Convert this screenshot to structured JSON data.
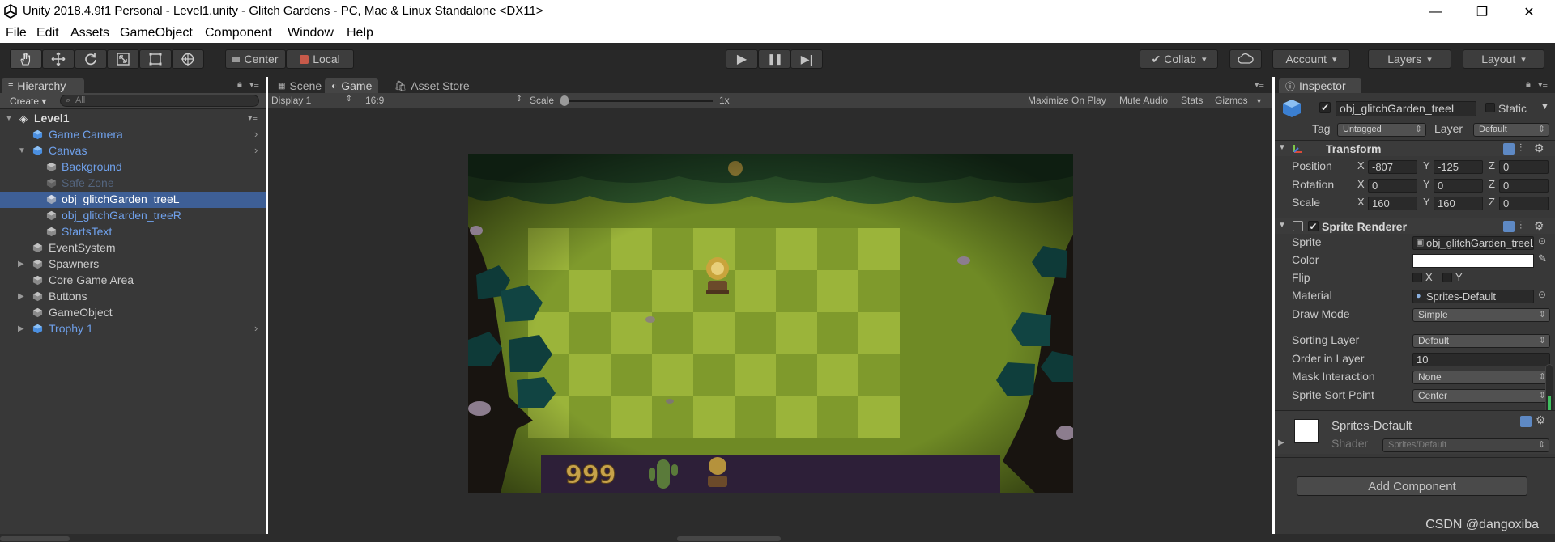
{
  "window": {
    "title": "Unity 2018.4.9f1 Personal - Level1.unity - Glitch Gardens - PC, Mac & Linux Standalone <DX11>",
    "min_glyph": "—",
    "max_glyph": "❐",
    "close_glyph": "✕"
  },
  "menu": [
    "File",
    "Edit",
    "Assets",
    "GameObject",
    "Component",
    "Window",
    "Help"
  ],
  "toolbar": {
    "tools": [
      "hand-tool-icon",
      "move-tool-icon",
      "rotate-tool-icon",
      "scale-tool-icon",
      "rect-tool-icon",
      "transform-tool-icon"
    ],
    "pivot": "Center",
    "space": "Local",
    "play_glyph": "▶",
    "pause_glyph": "❚❚",
    "step_glyph": "▶|",
    "collab": "Collab",
    "account": "Account",
    "layers": "Layers",
    "layout": "Layout"
  },
  "hierarchy": {
    "tab": "Hierarchy",
    "create": "Create",
    "search_placeholder": "All",
    "scene": "Level1",
    "items": [
      {
        "label": "Game Camera"
      },
      {
        "label": "Canvas"
      },
      {
        "label": "Background"
      },
      {
        "label": "Safe Zone"
      },
      {
        "label": "obj_glitchGarden_treeL"
      },
      {
        "label": "obj_glitchGarden_treeR"
      },
      {
        "label": "StartsText"
      },
      {
        "label": "EventSystem"
      },
      {
        "label": "Spawners"
      },
      {
        "label": "Core Game Area"
      },
      {
        "label": "Buttons"
      },
      {
        "label": "GameObject"
      },
      {
        "label": "Trophy 1"
      }
    ]
  },
  "center": {
    "tabs": [
      "Scene",
      "Game",
      "Asset Store"
    ],
    "display": "Display 1",
    "aspect": "16:9",
    "scale_label": "Scale",
    "scale_value": "1x",
    "scale_level": 0.0,
    "maximize": "Maximize On Play",
    "mute": "Mute Audio",
    "stats": "Stats",
    "gizmos": "Gizmos",
    "game_star_count": "999"
  },
  "inspector": {
    "tab": "Inspector",
    "object_name": "obj_glitchGarden_treeL",
    "static_label": "Static",
    "tag_label": "Tag",
    "tag_value": "Untagged",
    "layer_label": "Layer",
    "layer_value": "Default",
    "transform": {
      "title": "Transform",
      "position_label": "Position",
      "rotation_label": "Rotation",
      "scale_label": "Scale",
      "position": {
        "x": "-807",
        "y": "-125",
        "z": "0"
      },
      "rotation": {
        "x": "0",
        "y": "0",
        "z": "0"
      },
      "scale": {
        "x": "160",
        "y": "160",
        "z": "0"
      }
    },
    "sprite_renderer": {
      "title": "Sprite Renderer",
      "sprite_label": "Sprite",
      "sprite_value": "obj_glitchGarden_treeL",
      "color_label": "Color",
      "color_value": "#ffffff",
      "flip_label": "Flip",
      "flip_x": "X",
      "flip_y": "Y",
      "material_label": "Material",
      "material_value": "Sprites-Default",
      "draw_mode_label": "Draw Mode",
      "draw_mode_value": "Simple",
      "sorting_layer_label": "Sorting Layer",
      "sorting_layer_value": "Default",
      "order_label": "Order in Layer",
      "order_value": "10",
      "mask_label": "Mask Interaction",
      "mask_value": "None",
      "sort_point_label": "Sprite Sort Point",
      "sort_point_value": "Center"
    },
    "material_asset": {
      "name": "Sprites-Default",
      "shader_label": "Shader",
      "shader_value": "Sprites/Default"
    },
    "add_component": "Add Component"
  },
  "watermark": "CSDN @dangoxiba",
  "colors": {
    "editor_bg": "#383838",
    "selection": "#3e5f96",
    "prefab_blue": "#6fa0ea",
    "grass_light": "#9bb43a",
    "grass_dark": "#7f9a2c",
    "hud_purple": "#2d1f38"
  }
}
